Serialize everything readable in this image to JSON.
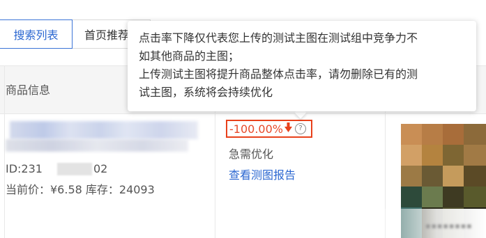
{
  "tabs": [
    {
      "label": "搜索列表",
      "active": true
    },
    {
      "label": "首页推荐",
      "active": false
    }
  ],
  "table": {
    "header_product_info": "商品信息"
  },
  "product": {
    "title_line1": "",
    "id_prefix": "ID:231",
    "id_suffix": "02",
    "price_stock": "当前价：¥6.58  库存：24093"
  },
  "metric": {
    "value": "-100.00%",
    "trend_icon": "down-arrow-icon",
    "help_icon": "question-circle-icon",
    "status": "急需优化",
    "report_link": "查看测图报告",
    "color": "#e8411b"
  },
  "tooltip": {
    "lines": [
      "点击率下降仅代表您上传的测试主图在测试组中竞争力不",
      "如其他商品的主图；",
      "上传测试主图将提升商品整体点击率，请勿删除已有的测",
      "试主图，系统将会持续优化"
    ]
  },
  "colors": {
    "accent": "#2b67d1",
    "warning": "#e8411b"
  }
}
